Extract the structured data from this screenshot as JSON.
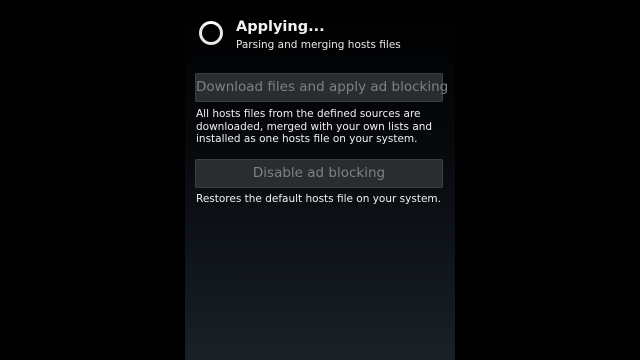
{
  "status": {
    "title": "Applying...",
    "subtitle": "Parsing and merging hosts files",
    "indicator": "progress-spinner"
  },
  "actions": {
    "download": {
      "label": "Download files and apply ad blocking",
      "description": "All hosts files from the defined sources are downloaded, merged with your own lists and installed as one hosts file on your system.",
      "enabled": false
    },
    "disable": {
      "label": "Disable ad blocking",
      "description": "Restores the default hosts file on your system.",
      "enabled": false
    }
  },
  "colors": {
    "background": "#000000",
    "button_disabled_bg": "#2a2d2f",
    "button_disabled_text": "#7d8184",
    "text": "#f0f0f0"
  }
}
